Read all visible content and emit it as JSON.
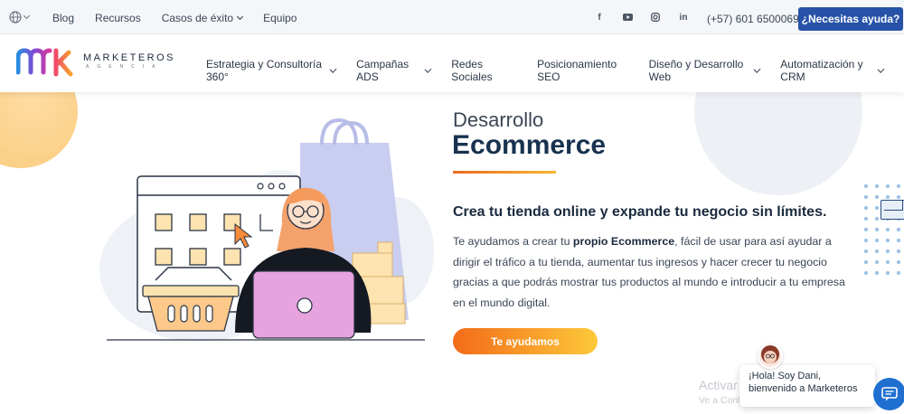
{
  "topbar": {
    "links": [
      "Blog",
      "Recursos",
      "Casos de éxito",
      "Equipo"
    ],
    "phone": "(+57) 601 6500069",
    "help_button": "¿Necesitas ayuda?"
  },
  "brand": {
    "name": "MARKETEROS",
    "sub": "AGENCIA"
  },
  "nav": {
    "items": [
      {
        "label": "Estrategia y Consultoría 360°",
        "dropdown": true
      },
      {
        "label": "Campañas ADS",
        "dropdown": true
      },
      {
        "label": "Redes Sociales",
        "dropdown": false
      },
      {
        "label": "Posicionamiento SEO",
        "dropdown": false
      },
      {
        "label": "Diseño y Desarrollo Web",
        "dropdown": true
      },
      {
        "label": "Automatización y CRM",
        "dropdown": true
      }
    ]
  },
  "hero": {
    "kicker": "Desarrollo",
    "title": "Ecommerce",
    "subtitle": "Crea tu tienda online y expande tu negocio sin límites.",
    "body_before": "Te ayudamos a crear tu ",
    "body_bold": "propio Ecommerce",
    "body_after": ", fácil de usar para así ayudar a dirigir el tráfico a tu tienda, aumentar tus ingresos y hacer crecer tu negocio gracias a que podrás mostrar tus productos al mundo e introducir a tu empresa en el mundo digital.",
    "cta": "Te ayudamos"
  },
  "chat": {
    "line1": "¡Hola! Soy Dani,",
    "line2": "bienvenido a Marketeros"
  },
  "watermark": {
    "line1": "Activar Windows",
    "line2": "Ve a Configuración para activar Windows."
  },
  "colors": {
    "accent_blue": "#2752a8",
    "cta_start": "#f36b19",
    "cta_end": "#fdc93a",
    "title": "#18324f"
  }
}
